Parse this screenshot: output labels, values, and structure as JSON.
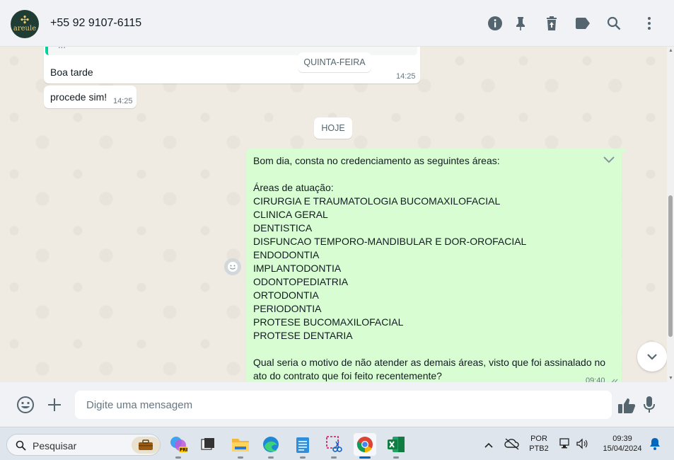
{
  "header": {
    "avatar_brand": "areule",
    "contact_name": "+55 92 9107-6115",
    "icons": [
      "info-icon",
      "pin-icon",
      "trash-icon",
      "label-icon",
      "search-icon",
      "kebab-menu-icon"
    ]
  },
  "chat": {
    "quoted_text": "...",
    "messages_in": [
      {
        "text": "Boa tarde",
        "time": "14:25"
      },
      {
        "text": "procede sim!",
        "time": "14:25"
      }
    ],
    "day_labels": [
      "QUINTA-FEIRA",
      "HOJE"
    ],
    "message_out": {
      "text": "Bom dia, consta no credenciamento as seguintes áreas:\n\nÁreas de atuação:\nCIRURGIA E TRAUMATOLOGIA BUCOMAXILOFACIAL\nCLINICA GERAL\nDENTISTICA\nDISFUNCAO TEMPORO-MANDIBULAR E DOR-OROFACIAL\nENDODONTIA\nIMPLANTODONTIA\nODONTOPEDIATRIA\nORTODONTIA\nPERIODONTIA\nPROTESE BUCOMAXILOFACIAL\nPROTESE DENTARIA\n\nQual seria o motivo de não atender as demais áreas, visto que foi assinalado no ato do contrato que foi feito recentemente?",
      "time": "09:40",
      "status": "read"
    }
  },
  "composer": {
    "placeholder": "Digite uma mensagem"
  },
  "taskbar": {
    "search_label": "Pesquisar",
    "apps": [
      "copilot",
      "task-view",
      "file-explorer",
      "edge",
      "notepad",
      "snipping-tool",
      "chrome",
      "excel"
    ],
    "active_app": "chrome",
    "language_line1": "POR",
    "language_line2": "PTB2",
    "time": "09:39",
    "date": "15/04/2024"
  },
  "colors": {
    "accent": "#00a884",
    "outgoing_bubble": "#d9fdd3",
    "chat_bg": "#efeae2"
  }
}
